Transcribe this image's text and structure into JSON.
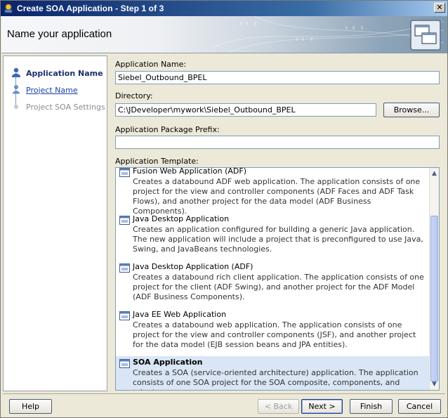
{
  "window": {
    "title": "Create SOA Application - Step 1 of 3",
    "close_glyph": "✕"
  },
  "header": {
    "title": "Name your application"
  },
  "nav": {
    "items": [
      {
        "label": "Application Name",
        "state": "current"
      },
      {
        "label": "Project Name",
        "state": "link"
      },
      {
        "label": "Project SOA Settings",
        "state": "disabled"
      }
    ]
  },
  "form": {
    "app_name_label": "Application Name:",
    "app_name_value": "Siebel_Outbound_BPEL",
    "directory_label": "Directory:",
    "directory_value": "C:\\JDeveloper\\mywork\\Siebel_Outbound_BPEL",
    "browse_label": "Browse...",
    "package_prefix_label": "Application Package Prefix:",
    "package_prefix_value": "",
    "template_label": "Application Template:"
  },
  "templates": [
    {
      "name": "Fusion Web Application (ADF)",
      "desc": "Creates a databound ADF web application. The application consists of one project for the view and controller components (ADF Faces and ADF Task Flows), and another project for the data model (ADF Business Components).",
      "selected": false
    },
    {
      "name": "Java Desktop Application",
      "desc": "Creates an application configured for building a generic Java application. The new application will include a project that is preconfigured to use Java, Swing, and JavaBeans technologies.",
      "selected": false
    },
    {
      "name": "Java Desktop Application (ADF)",
      "desc": "Creates a databound rich client application. The application consists of one project for the client (ADF Swing), and another project for the ADF Model (ADF Business Components).",
      "selected": false
    },
    {
      "name": "Java EE Web Application",
      "desc": "Creates a databound web application. The application consists of one project for the view and controller components (JSF), and another project for the data model (EJB session beans and JPA entities).",
      "selected": false
    },
    {
      "name": "SOA Application",
      "desc": "Creates a SOA (service-oriented architecture) application. The application consists of one SOA project for the SOA composite, components, and adapters.",
      "selected": true
    }
  ],
  "footer": {
    "help": "Help",
    "back": "< Back",
    "next": "Next >",
    "finish": "Finish",
    "cancel": "Cancel"
  },
  "colors": {
    "title_bar": "#0a246a",
    "selection": "#dae6f5",
    "link": "#1a3ea8"
  }
}
